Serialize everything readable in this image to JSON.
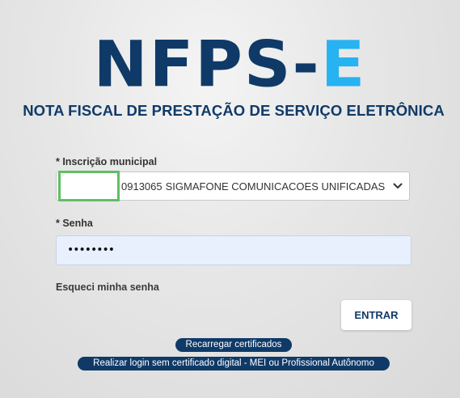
{
  "logo": {
    "main": "NFPS",
    "hyphen": "-",
    "accent": "E",
    "color_main": "#0f3a68",
    "color_accent": "#27b2f2"
  },
  "subtitle": "NOTA FISCAL DE PRESTAÇÃO DE SERVIÇO ELETRÔNICA",
  "form": {
    "inscricao_label": "* Inscrição municipal",
    "inscricao_code": "0913065",
    "inscricao_name": "SIGMAFONE COMUNICACOES UNIFICADAS LTDA EP",
    "senha_label": "* Senha",
    "senha_value": "••••••••",
    "forgot_label": "Esqueci minha senha",
    "submit_label": "ENTRAR"
  },
  "actions": {
    "reload_label": "Recarregar certificados",
    "login_no_cert_label": "Realizar login sem certificado digital - MEI ou Profissional Autônomo"
  },
  "icons": {
    "select_arrow": "chevron-down-icon"
  },
  "colors": {
    "brand_navy": "#0f3a68",
    "brand_blue": "#27b2f2",
    "highlight_green": "#5fbf63",
    "password_autofill_bg": "#e8f0fe"
  }
}
